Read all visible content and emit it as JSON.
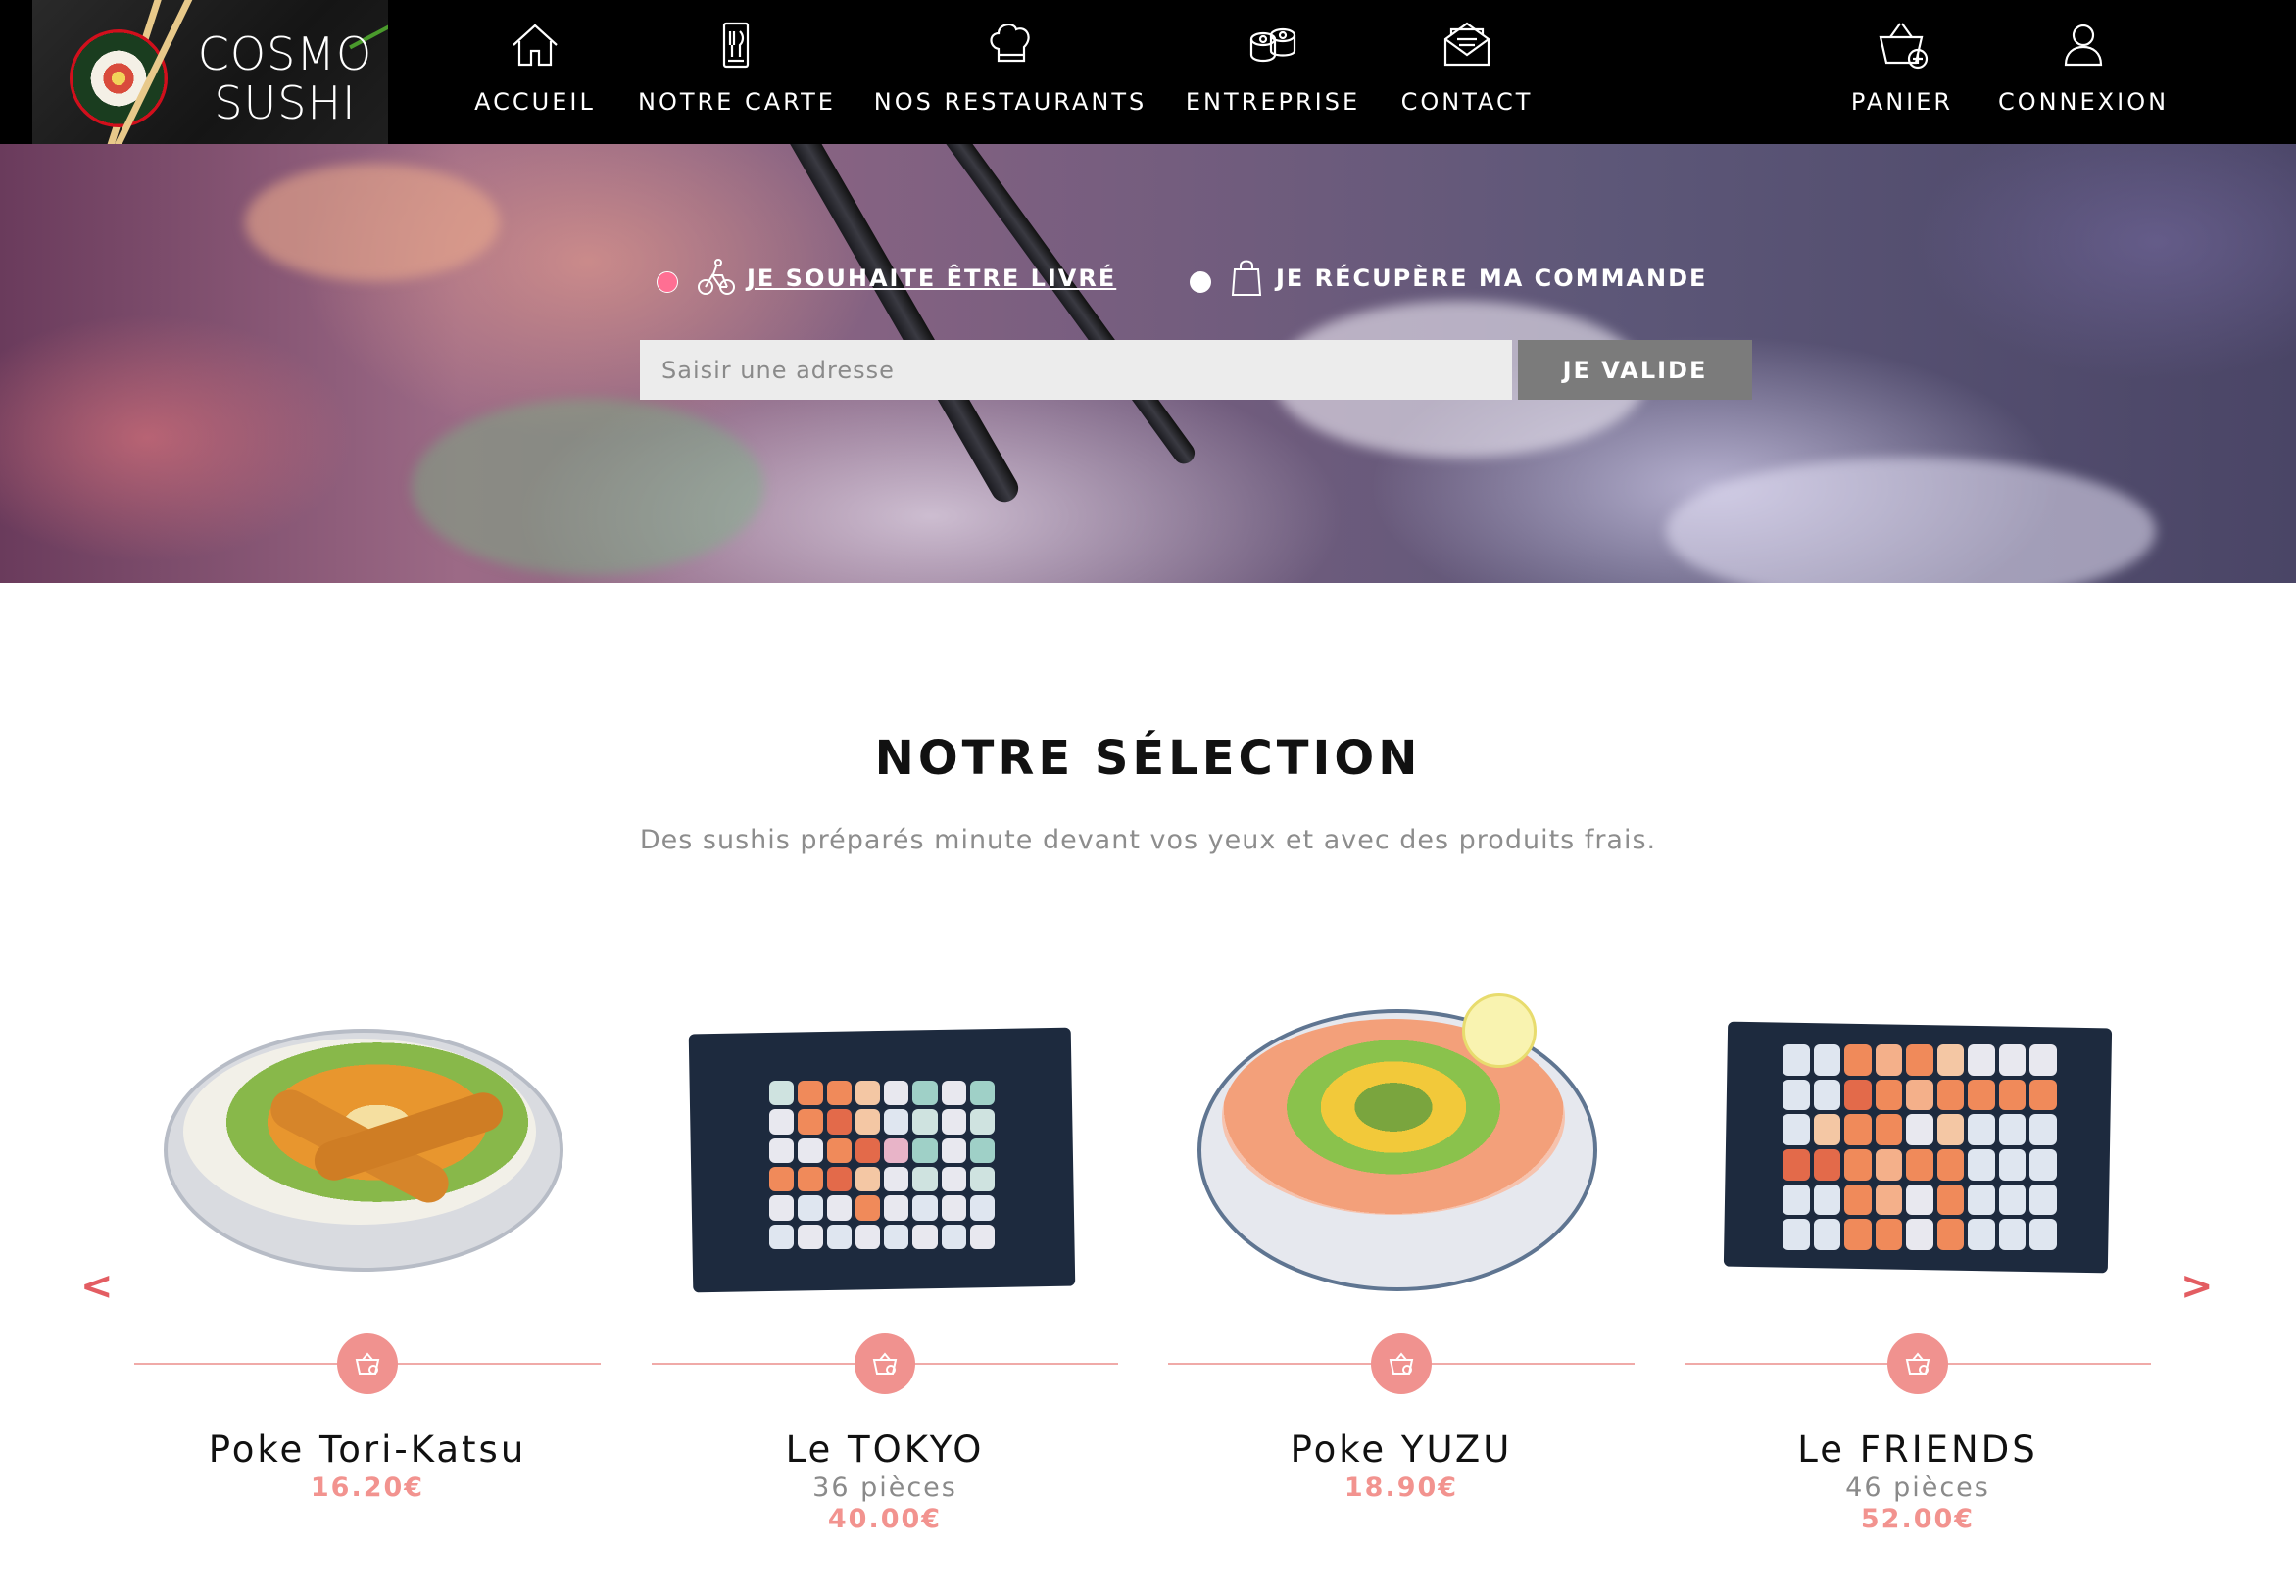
{
  "brand": {
    "line1": "COSMO",
    "line2": "SUSHI"
  },
  "nav": {
    "items": [
      {
        "label": "ACCUEIL",
        "icon": "house-icon"
      },
      {
        "label": "NOTRE CARTE",
        "icon": "menu-card-icon"
      },
      {
        "label": "NOS RESTAURANTS",
        "icon": "chef-hat-icon"
      },
      {
        "label": "ENTREPRISE",
        "icon": "sushi-rolls-icon"
      },
      {
        "label": "CONTACT",
        "icon": "envelope-icon"
      }
    ],
    "right": [
      {
        "label": "PANIER",
        "icon": "basket-icon"
      },
      {
        "label": "CONNEXION",
        "icon": "user-icon"
      }
    ]
  },
  "hero": {
    "delivery_label": "JE SOUHAITE ÊTRE LIVRÉ",
    "pickup_label": "JE RÉCUPÈRE MA COMMANDE",
    "address_placeholder": "Saisir une adresse",
    "address_value": "",
    "validate_label": "JE VALIDE",
    "selected_option": "delivery"
  },
  "selection": {
    "title": "NOTRE SÉLECTION",
    "subtitle": "Des sushis préparés minute devant vos yeux et avec des produits frais.",
    "prev_label": "<",
    "next_label": ">",
    "products": [
      {
        "name": "Poke Tori-Katsu",
        "pieces": "",
        "price": "16.20€"
      },
      {
        "name": "Le TOKYO",
        "pieces": "36 pièces",
        "price": "40.00€"
      },
      {
        "name": "Poke YUZU",
        "pieces": "",
        "price": "18.90€"
      },
      {
        "name": "Le FRIENDS",
        "pieces": "46 pièces",
        "price": "52.00€"
      }
    ]
  },
  "colors": {
    "nav_bg": "#000000",
    "accent_pink": "#f0928f",
    "radio_selected": "#ff6f93",
    "button_grey": "#7b7b7b"
  }
}
